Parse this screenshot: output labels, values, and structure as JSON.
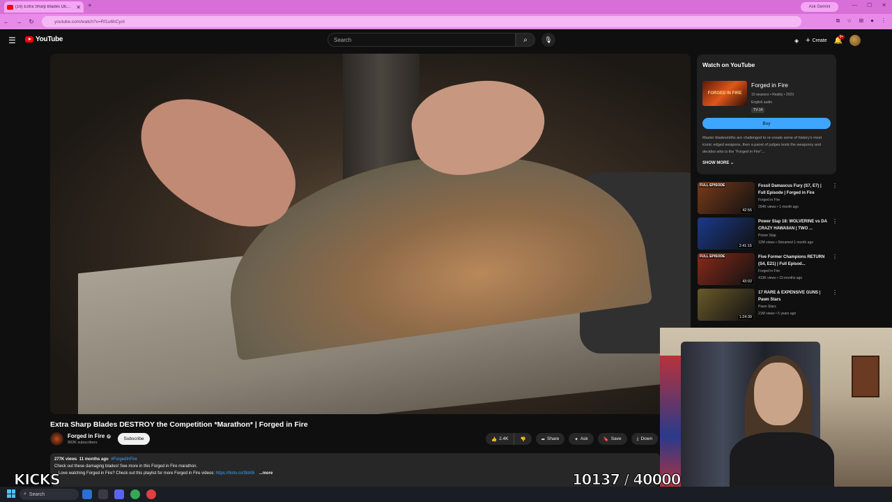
{
  "browser": {
    "tab_title": "(16) Extra Sharp Blades DE...",
    "url": "youtube.com/watch?v=Rf1u6hCyoI",
    "ask_gemini": "Ask Gemini",
    "accent_color": "#e88be8"
  },
  "yt_header": {
    "logo_text": "YouTube",
    "search_placeholder": "Search",
    "create_label": "Create",
    "notification_count": "9+"
  },
  "video": {
    "title": "Extra Sharp Blades DESTROY the Competition *Marathon* | Forged in Fire",
    "channel": "Forged in Fire",
    "subscribers": "992K subscribers",
    "subscribe_label": "Subscribe",
    "likes": "2.4K",
    "share_label": "Share",
    "ask_label": "Ask",
    "save_label": "Save",
    "download_label": "Down",
    "views": "277K views",
    "age": "11 months ago",
    "hashtag": "#ForgedInFire",
    "desc_line1": "Check out these damaging blades! See more in this Forged in Fire marathon.",
    "desc_line2_prefix": "Love watching Forged in Fire? Check out this playlist for more Forged in Fire videos:",
    "desc_link": "https://histv.co/3lsh9i",
    "more_label": "...more"
  },
  "watch_card": {
    "heading": "Watch on YouTube",
    "show_title": "Forged in Fire",
    "seasons": "10 seasons • Reality • 2023",
    "audio": "English audio",
    "rating": "TV-14",
    "thumb_text": "FORGED IN FIRE",
    "buy_label": "Buy",
    "description": "Master bladesmiths are challenged to re-create some of history's most iconic edged weapons, then a panel of judges tests the weaponry and decides who is the \"Forged in Fire\"...",
    "show_more": "SHOW MORE"
  },
  "recommendations": [
    {
      "title": "Fossil Damascus Fury (S7, E7) | Full Episode | Forged in Fire",
      "channel": "Forged in Fire",
      "meta": "264K views • 1 month ago",
      "duration": "42:55",
      "label": "FULL EPISODE",
      "color": "#7a3a1a"
    },
    {
      "title": "Power Slap 18: WOLVERINE vs DA CRAZY HAWAIIAN | TWO ...",
      "channel": "Power Slap",
      "meta": "12M views • Streamed 1 month ago",
      "duration": "2:41:15",
      "label": "",
      "color": "#1a3a8a"
    },
    {
      "title": "Five Former Champions RETURN (S4, E21) | Full Episod...",
      "channel": "Forged in Fire",
      "meta": "413K views • 10 months ago",
      "duration": "43:02",
      "label": "FULL EPISODE",
      "color": "#8a2a1a"
    },
    {
      "title": "17 RARE & EXPENSIVE GUNS | Pawn Stars",
      "channel": "Pawn Stars",
      "meta": "21M views • 5 years ago",
      "duration": "1:24:39",
      "label": "",
      "color": "#6a5a2a"
    }
  ],
  "overlay": {
    "kicks_label": "KICKS",
    "counter": "10137 / 40000"
  },
  "taskbar": {
    "search_label": "Search"
  }
}
